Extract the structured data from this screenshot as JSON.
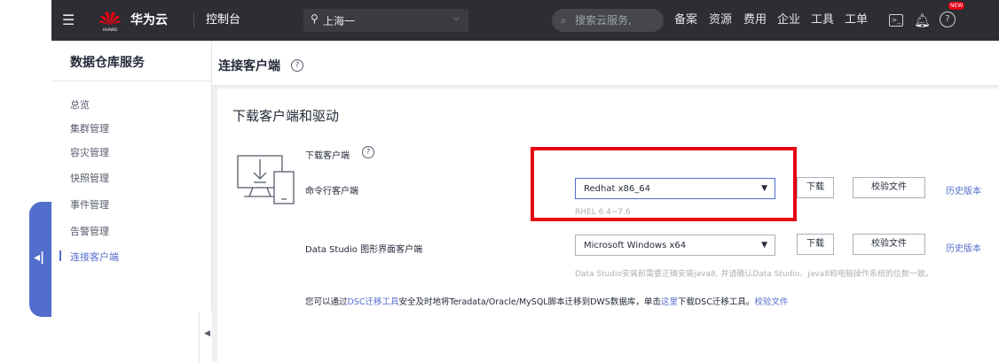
{
  "topbar": {
    "brand_logo_text": "HUAWEI",
    "brand": "华为云",
    "console": "控制台",
    "region": "上海一",
    "search_placeholder": "搜索云服务,",
    "menu": [
      "备案",
      "资源",
      "费用",
      "企业",
      "工具",
      "工单"
    ],
    "badge": "NEW"
  },
  "sidebar": {
    "title": "数据仓库服务",
    "items": [
      {
        "label": "总览"
      },
      {
        "label": "集群管理"
      },
      {
        "label": "容灾管理"
      },
      {
        "label": "快照管理"
      },
      {
        "label": "事件管理"
      },
      {
        "label": "告警管理"
      },
      {
        "label": "连接客户端"
      }
    ]
  },
  "page": {
    "title": "连接客户端",
    "section_title": "下载客户端和驱动",
    "download_client_label": "下载客户端",
    "cli": {
      "label": "命令行客户端",
      "selected": "Redhat x86_64",
      "hint": "RHEL 6.4~7.6",
      "download": "下载",
      "checksum": "校验文件",
      "history": "历史版本"
    },
    "gui": {
      "label": "Data Studio 图形界面客户端",
      "selected": "Microsoft Windows x64",
      "hint": "Data Studio安装前需要正确安装java8, 并请确认Data Studio、java8和电脑操作系统的位数一致。",
      "download": "下载",
      "checksum": "校验文件",
      "history": "历史版本"
    },
    "note": {
      "prefix": "您可以通过",
      "link1": "DSC迁移工具",
      "middle": "安全及时地将Teradata/Oracle/MySQL脚本迁移到DWS数据库，单击",
      "link2": "这里",
      "suffix": "下载DSC迁移工具。",
      "link3": "校验文件"
    }
  },
  "colors": {
    "accent": "#526ecc",
    "highlight": "#e60012",
    "topbar": "#2c2e33"
  }
}
